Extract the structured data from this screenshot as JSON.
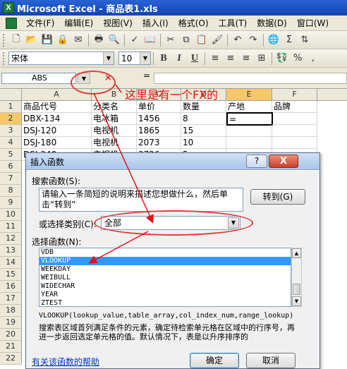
{
  "window": {
    "title": "Microsoft Excel - 商品表1.xls",
    "app_icon": "X"
  },
  "menu": {
    "items": [
      "文件(F)",
      "编辑(E)",
      "视图(V)",
      "插入(I)",
      "格式(O)",
      "工具(T)",
      "数据(D)",
      "窗口(W)"
    ]
  },
  "format_toolbar": {
    "font_name": "宋体",
    "font_size": "10",
    "bold": "B",
    "italic": "I",
    "underline": "U",
    "percent": "%"
  },
  "formula_bar": {
    "name_box": "ABS",
    "cancel_symbol": "×",
    "equals": "=",
    "content": ""
  },
  "annotation": {
    "text": "这里是有一个FX的",
    "color": "#e21414"
  },
  "sheet": {
    "columns": [
      "A",
      "B",
      "C",
      "D",
      "E",
      "F"
    ],
    "rows": [
      "1",
      "2",
      "3",
      "4",
      "5",
      "6",
      "7",
      "8",
      "9",
      "10",
      "11",
      "12",
      "13",
      "14",
      "15",
      "16",
      "17",
      "18",
      "19",
      "20",
      "21",
      "22"
    ],
    "cells": [
      [
        "商品代号",
        "分类名",
        "单价",
        "数量",
        "产地",
        "品牌"
      ],
      [
        "DBX-134",
        "电冰箱",
        "1456",
        "8",
        "=",
        ""
      ],
      [
        "DSJ-120",
        "电视机",
        "1865",
        "15",
        "",
        ""
      ],
      [
        "DSJ-180",
        "电视机",
        "2073",
        "10",
        "",
        ""
      ],
      [
        "DSJ-340",
        "电视机",
        "3726",
        "5",
        "",
        ""
      ]
    ],
    "active_cell": "E2"
  },
  "dialog": {
    "title": "插入函数",
    "help_button": "?",
    "close_button": "X",
    "search_label": "搜索函数(S):",
    "search_text": "请输入一条简短的说明来描述您想做什么，然后单击“转到”",
    "goto_button": "转到(G)",
    "category_label": "或选择类别(C):",
    "category_value": "全部",
    "function_label": "选择函数(N):",
    "functions": [
      "VDB",
      "VLOOKUP",
      "WEEKDAY",
      "WEIBULL",
      "WIDECHAR",
      "YEAR",
      "ZTEST"
    ],
    "selected_function": "VLOOKUP",
    "signature": "VLOOKUP(lookup_value,table_array,col_index_num,range_lookup)",
    "description": "搜索表区域首列满足条件的元素，确定待检索单元格在区域中的行序号，再进一步返回选定单元格的值。默认情况下，表是以升序排序的",
    "help_link": "有关该函数的帮助",
    "ok_button": "确定",
    "cancel_button": "取消"
  },
  "colors": {
    "titlebar": "#1b4fc0",
    "annotation": "#e21414",
    "selection": "#3399ff"
  }
}
